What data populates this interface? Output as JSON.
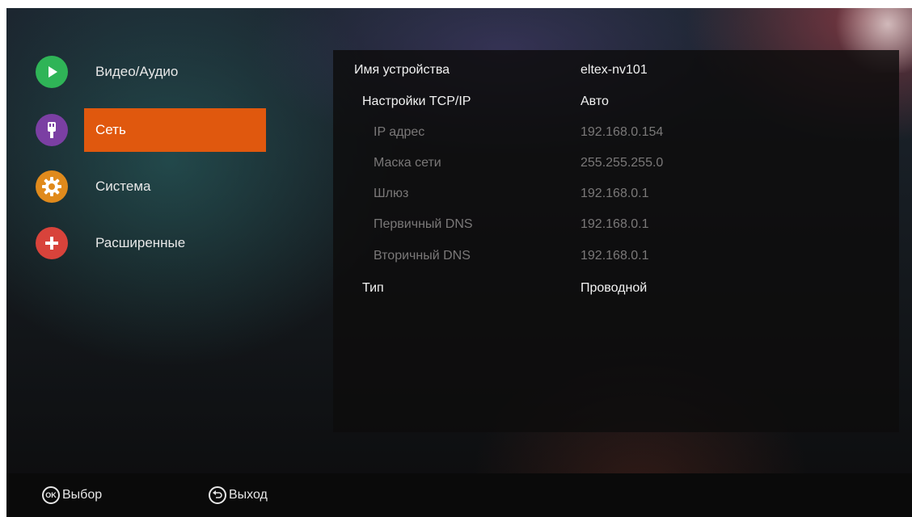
{
  "sidebar": {
    "items": [
      {
        "label": "Видео/Аудио",
        "icon": "play-icon",
        "color": "#2fb457"
      },
      {
        "label": "Сеть",
        "icon": "network-plug-icon",
        "color": "#7b3fa3",
        "active": true
      },
      {
        "label": "Система",
        "icon": "gear-icon",
        "color": "#e08a1c"
      },
      {
        "label": "Расширенные",
        "icon": "plus-icon",
        "color": "#d8433b"
      }
    ],
    "active_color": "#e0580e"
  },
  "settings": {
    "rows": [
      {
        "label": "Имя устройства",
        "value": "eltex-nv101",
        "style": "primary"
      },
      {
        "label": "Настройки TCP/IP",
        "value": "Авто",
        "style": "primary"
      },
      {
        "label": "IP адрес",
        "value": "192.168.0.154",
        "style": "dim"
      },
      {
        "label": "Маска сети",
        "value": "255.255.255.0",
        "style": "dim"
      },
      {
        "label": "Шлюз",
        "value": "192.168.0.1",
        "style": "dim"
      },
      {
        "label": "Первичный DNS",
        "value": "192.168.0.1",
        "style": "dim"
      },
      {
        "label": "Вторичный DNS",
        "value": "192.168.0.1",
        "style": "dim"
      },
      {
        "label": "Тип",
        "value": "Проводной",
        "style": "primary"
      }
    ]
  },
  "footer": {
    "ok_badge": "OK",
    "select_label": "Выбор",
    "back_icon": "back-arrow-icon",
    "exit_label": "Выход"
  }
}
